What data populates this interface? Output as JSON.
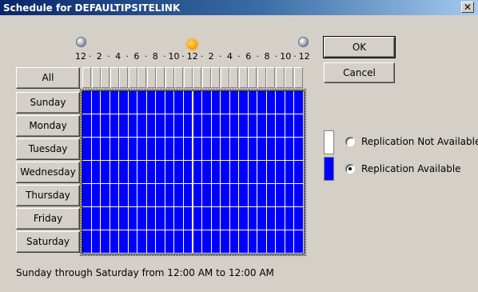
{
  "window": {
    "title": "Schedule for DEFAULTIPSITELINK",
    "close_glyph": "✕"
  },
  "timebar": {
    "labels": [
      "12",
      "2",
      "4",
      "6",
      "8",
      "10",
      "12",
      "2",
      "4",
      "6",
      "8",
      "10",
      "12"
    ],
    "separator": "·",
    "icons": [
      "moon-icon",
      "sun-icon",
      "moon-icon"
    ]
  },
  "rows": {
    "all_label": "All",
    "days": [
      "Sunday",
      "Monday",
      "Tuesday",
      "Wednesday",
      "Thursday",
      "Friday",
      "Saturday"
    ]
  },
  "grid": {
    "hours_per_day": 24,
    "selection": "all hours available"
  },
  "buttons": {
    "ok_label": "OK",
    "cancel_label": "Cancel"
  },
  "legend": {
    "not_available_label": "Replication Not Available",
    "available_label": "Replication Available",
    "selected": "available"
  },
  "colors": {
    "available": "#0000ff",
    "not_available": "#ffffff",
    "dialog_bg": "#d4d0c8"
  },
  "status_text": "Sunday through Saturday from 12:00 AM to 12:00 AM"
}
